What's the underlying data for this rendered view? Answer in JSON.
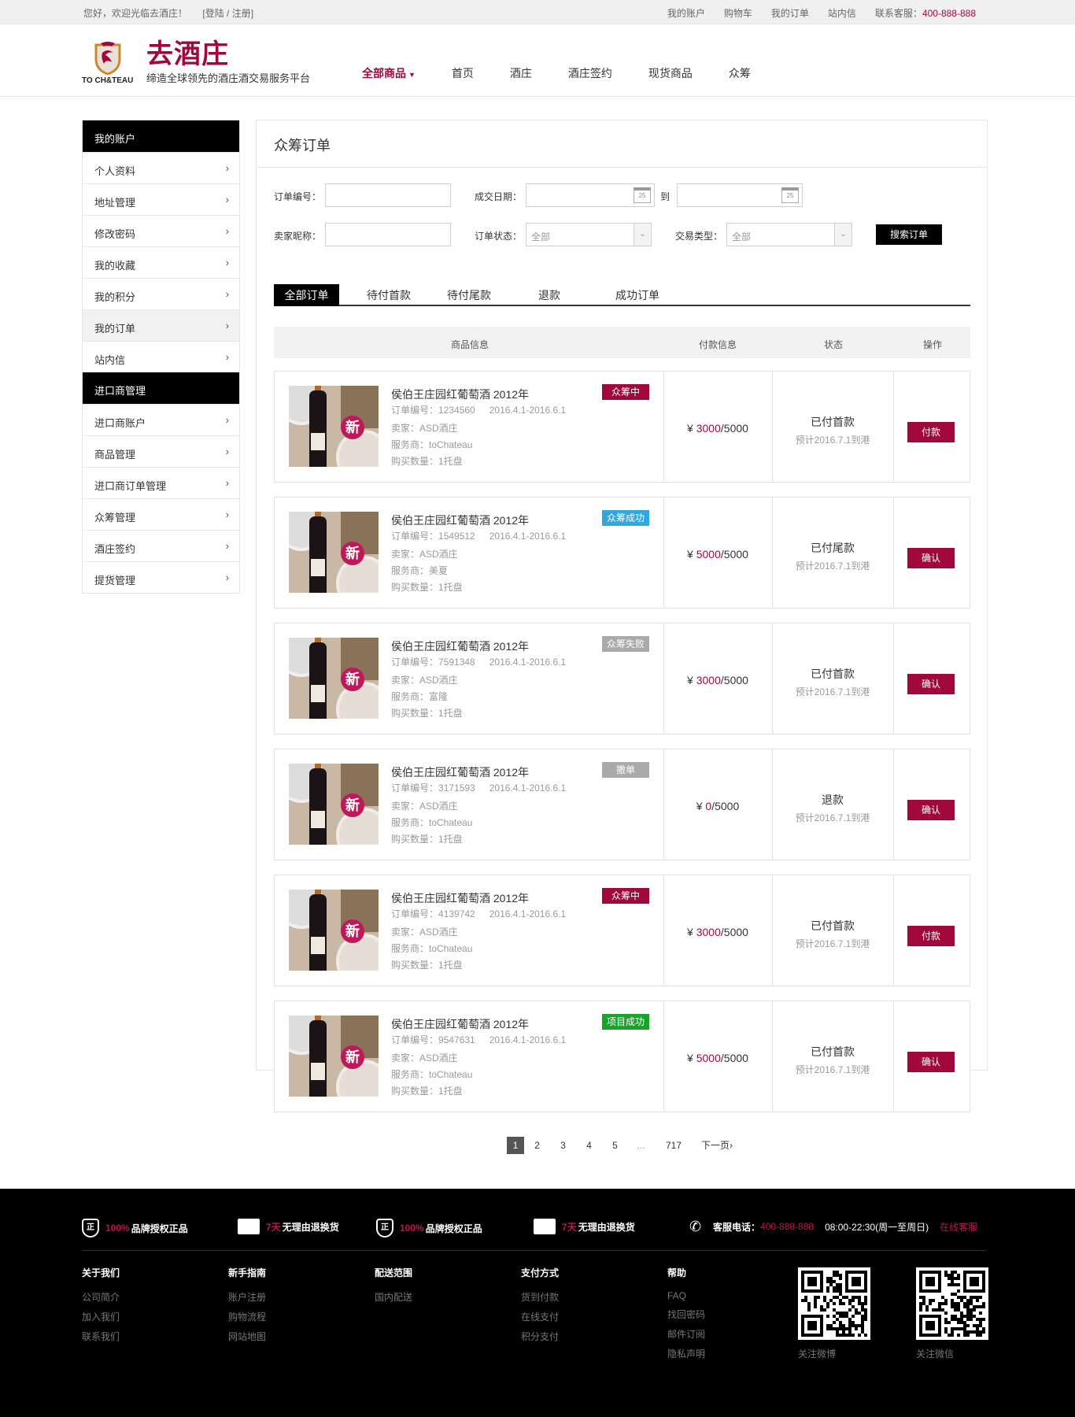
{
  "topbar": {
    "welcome": "您好，欢迎光临去酒庄！",
    "login": "[登陆 / 注册]",
    "links": [
      "我的账户",
      "购物车",
      "我的订单",
      "站内信"
    ],
    "service_label": "联系客服：",
    "service_phone": "400-888-888"
  },
  "header": {
    "logo_text": "TO CH&TEAU",
    "brand": "去酒庄",
    "slogan": "缔造全球领先的酒庄酒交易服务平台",
    "nav": [
      "全部商品",
      "首页",
      "酒庄",
      "酒庄签约",
      "现货商品",
      "众筹"
    ]
  },
  "sidebar": {
    "section1": "我的账户",
    "items1": [
      "个人资料",
      "地址管理",
      "修改密码",
      "我的收藏",
      "我的积分",
      "我的订单",
      "站内信"
    ],
    "section2": "进口商管理",
    "items2": [
      "进口商账户",
      "商品管理",
      "进口商订单管理",
      "众筹管理",
      "酒庄签约",
      "提货管理"
    ]
  },
  "main": {
    "title": "众筹订单",
    "form": {
      "order_no_label": "订单编号：",
      "date_label": "成交日期：",
      "to_label": "到",
      "buyer_label": "卖家昵称：",
      "status_label": "订单状态：",
      "status_value": "全部",
      "type_label": "交易类型：",
      "type_value": "全部",
      "calendar_day": "25",
      "search_button": "搜索订单"
    },
    "tabs": [
      "全部订单",
      "待付首款",
      "待付尾款",
      "退款",
      "成功订单"
    ],
    "table_headers": [
      "商品信息",
      "付款信息",
      "状态",
      "操作"
    ],
    "orders": [
      {
        "name": "侯伯王庄园红葡萄酒 2012年",
        "order_label": "订单编号：",
        "order_no": "1234560",
        "period": "2016.4.1-2016.6.1",
        "seller": "卖家：ASD酒庄",
        "agent": "服务商：toChateau",
        "qty": "购买数量：1托盘",
        "badge": "众筹中",
        "badge_color": "#a0083b",
        "currency": "¥",
        "paid": "3000",
        "total": "/5000",
        "status": "已付首款",
        "eta": "预计2016.7.1到港",
        "action": "付款"
      },
      {
        "name": "侯伯王庄园红葡萄酒 2012年",
        "order_label": "订单编号：",
        "order_no": "1549512",
        "period": "2016.4.1-2016.6.1",
        "seller": "卖家：ASD酒庄",
        "agent": "服务商：美夏",
        "qty": "购买数量：1托盘",
        "badge": "众筹成功",
        "badge_color": "#2fa8e0",
        "currency": "¥",
        "paid": "5000",
        "total": "/5000",
        "status": "已付尾款",
        "eta": "预计2016.7.1到港",
        "action": "确认"
      },
      {
        "name": "侯伯王庄园红葡萄酒 2012年",
        "order_label": "订单编号：",
        "order_no": "7591348",
        "period": "2016.4.1-2016.6.1",
        "seller": "卖家：ASD酒庄",
        "agent": "服务商：富隆",
        "qty": "购买数量：1托盘",
        "badge": "众筹失败",
        "badge_color": "#aaaaaa",
        "currency": "¥",
        "paid": "3000",
        "total": "/5000",
        "status": "已付首款",
        "eta": "预计2016.7.1到港",
        "action": "确认"
      },
      {
        "name": "侯伯王庄园红葡萄酒 2012年",
        "order_label": "订单编号：",
        "order_no": "3171593",
        "period": "2016.4.1-2016.6.1",
        "seller": "卖家：ASD酒庄",
        "agent": "服务商：toChateau",
        "qty": "购买数量：1托盘",
        "badge": "撤单",
        "badge_color": "#aaaaaa",
        "currency": "¥",
        "paid": "0",
        "total": "/5000",
        "status": "退款",
        "eta": "预计2016.7.1到港",
        "action": "确认"
      },
      {
        "name": "侯伯王庄园红葡萄酒 2012年",
        "order_label": "订单编号：",
        "order_no": "4139742",
        "period": "2016.4.1-2016.6.1",
        "seller": "卖家：ASD酒庄",
        "agent": "服务商：toChateau",
        "qty": "购买数量：1托盘",
        "badge": "众筹中",
        "badge_color": "#a0083b",
        "currency": "¥",
        "paid": "3000",
        "total": "/5000",
        "status": "已付首款",
        "eta": "预计2016.7.1到港",
        "action": "付款"
      },
      {
        "name": "侯伯王庄园红葡萄酒 2012年",
        "order_label": "订单编号：",
        "order_no": "9547631",
        "period": "2016.4.1-2016.6.1",
        "seller": "卖家：ASD酒庄",
        "agent": "服务商：toChateau",
        "qty": "购买数量：1托盘",
        "badge": "项目成功",
        "badge_color": "#1aa32a",
        "currency": "¥",
        "paid": "5000",
        "total": "/5000",
        "status": "已付首款",
        "eta": "预计2016.7.1到港",
        "action": "确认"
      }
    ],
    "image_text": "新",
    "pager": {
      "pages": [
        "1",
        "2",
        "3",
        "4",
        "5",
        "...",
        "717"
      ],
      "next": "下一页"
    }
  },
  "footer": {
    "guarantees": [
      {
        "icon": "shield-icon",
        "glyph": "正",
        "highlight": "100%",
        "text": "品牌授权正品"
      },
      {
        "icon": "truck-icon",
        "glyph": "",
        "highlight": "7天",
        "text": "无理由退换货"
      },
      {
        "icon": "shield-icon",
        "glyph": "正",
        "highlight": "100%",
        "text": "品牌授权正品"
      },
      {
        "icon": "truck-icon",
        "glyph": "",
        "highlight": "7天",
        "text": "无理由退换货"
      }
    ],
    "phone_label": "客服电话：",
    "phone": "400-888-888",
    "hours": "08:00-22:30(周一至周日)",
    "online": "在线客服",
    "columns": [
      {
        "title": "关于我们",
        "items": [
          "公司简介",
          "加入我们",
          "联系我们"
        ]
      },
      {
        "title": "新手指南",
        "items": [
          "账户注册",
          "购物流程",
          "网站地图"
        ]
      },
      {
        "title": "配送范围",
        "items": [
          "国内配送"
        ]
      },
      {
        "title": "支付方式",
        "items": [
          "货到付款",
          "在线支付",
          "积分支付"
        ]
      },
      {
        "title": "帮助",
        "items": [
          "FAQ",
          "找回密码",
          "邮件订阅",
          "隐私声明"
        ]
      }
    ],
    "qr1": "关注微博",
    "qr2": "关注微信"
  },
  "colors": {
    "accent": "#a0083b",
    "black": "#000000"
  }
}
